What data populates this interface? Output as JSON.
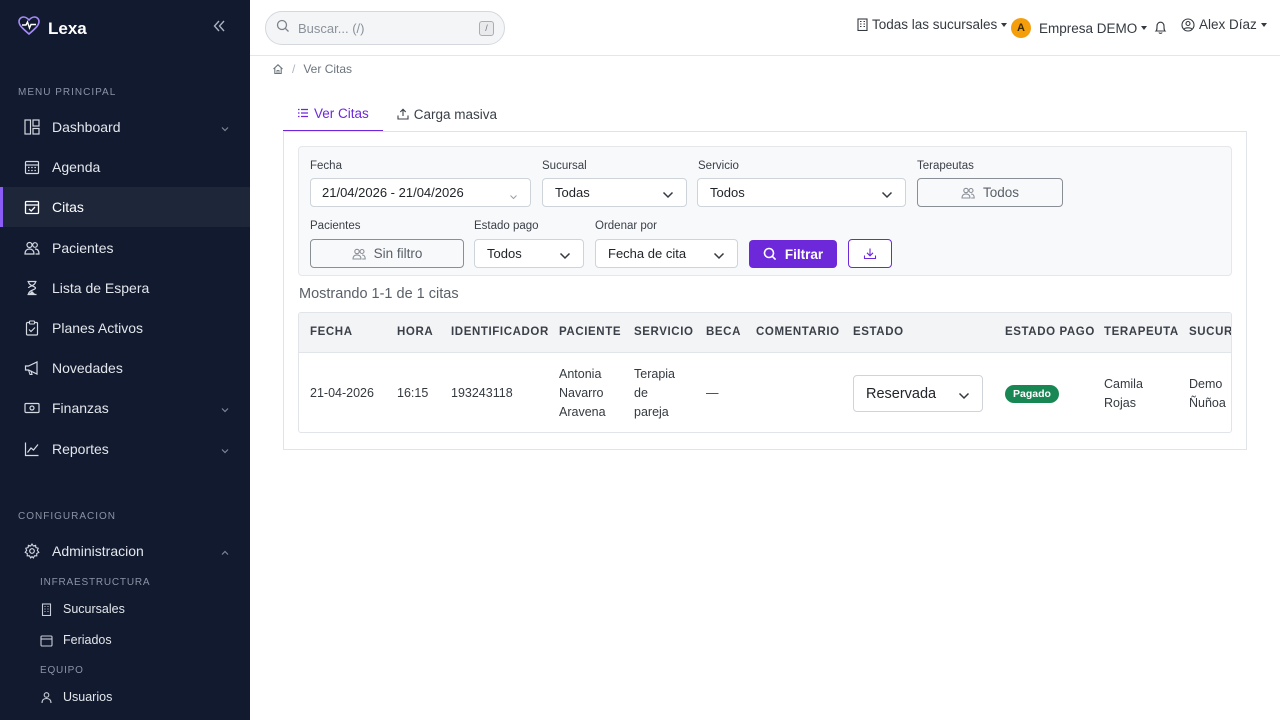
{
  "app": {
    "name": "Lexa",
    "brand_color": "#8b5cf6"
  },
  "sidebar": {
    "sections": [
      {
        "label": "MENU PRINCIPAL"
      },
      {
        "label": "CONFIGURACION"
      }
    ],
    "items": [
      {
        "label": "Dashboard",
        "icon": "dashboard-icon",
        "has_chevron": true
      },
      {
        "label": "Agenda",
        "icon": "calendar-icon"
      },
      {
        "label": "Citas",
        "icon": "calendar-check-icon",
        "active": true
      },
      {
        "label": "Pacientes",
        "icon": "users-icon"
      },
      {
        "label": "Lista de Espera",
        "icon": "hourglass-icon"
      },
      {
        "label": "Planes Activos",
        "icon": "clipboard-check-icon"
      },
      {
        "label": "Novedades",
        "icon": "megaphone-icon"
      },
      {
        "label": "Finanzas",
        "icon": "cash-icon",
        "has_chevron": true
      },
      {
        "label": "Reportes",
        "icon": "chart-line-icon",
        "has_chevron": true
      },
      {
        "label": "Administracion",
        "icon": "gear-icon",
        "expanded": true
      }
    ],
    "sub_sections": [
      {
        "label": "INFRAESTRUCTURA"
      },
      {
        "label": "EQUIPO"
      }
    ],
    "sub_items": [
      {
        "label": "Sucursales",
        "icon": "building-icon"
      },
      {
        "label": "Feriados",
        "icon": "calendar-small-icon"
      },
      {
        "label": "Usuarios",
        "icon": "user-icon"
      }
    ]
  },
  "topbar": {
    "search": {
      "placeholder": "Buscar... (/)",
      "shortcut": "/"
    },
    "branches_label": "Todas las sucursales",
    "company": {
      "initial": "A",
      "name": "Empresa DEMO"
    },
    "user": {
      "name": "Alex Díaz"
    }
  },
  "breadcrumb": {
    "current": "Ver Citas"
  },
  "tabs": [
    {
      "label": "Ver Citas",
      "active": true
    },
    {
      "label": "Carga masiva"
    }
  ],
  "filters": {
    "fecha": {
      "label": "Fecha",
      "value": "21/04/2026 - 21/04/2026"
    },
    "sucursal": {
      "label": "Sucursal",
      "value": "Todas"
    },
    "servicio": {
      "label": "Servicio",
      "value": "Todos"
    },
    "terapeutas": {
      "label": "Terapeutas",
      "value": "Todos"
    },
    "pacientes": {
      "label": "Pacientes",
      "value": "Sin filtro"
    },
    "estado_pago": {
      "label": "Estado pago",
      "value": "Todos"
    },
    "ordenar": {
      "label": "Ordenar por",
      "value": "Fecha de cita"
    },
    "filter_button": "Filtrar"
  },
  "results": {
    "showing": "Mostrando 1-1 de 1 citas"
  },
  "table": {
    "headers": [
      "FECHA",
      "HORA",
      "IDENTIFICADOR",
      "PACIENTE",
      "SERVICIO",
      "BECA",
      "COMENTARIO",
      "ESTADO",
      "ESTADO PAGO",
      "TERAPEUTA",
      "SUCURS"
    ],
    "rows": [
      {
        "fecha": "21-04-2026",
        "hora": "16:15",
        "identificador": "193243118",
        "paciente": [
          "Antonia",
          "Navarro",
          "Aravena"
        ],
        "servicio": [
          "Terapia",
          "de",
          "pareja"
        ],
        "beca": "—",
        "comentario": "",
        "estado": "Reservada",
        "estado_pago": "Pagado",
        "terapeuta": [
          "Camila",
          "Rojas"
        ],
        "sucursal": [
          "Demo",
          "Ñuñoa"
        ]
      }
    ]
  }
}
